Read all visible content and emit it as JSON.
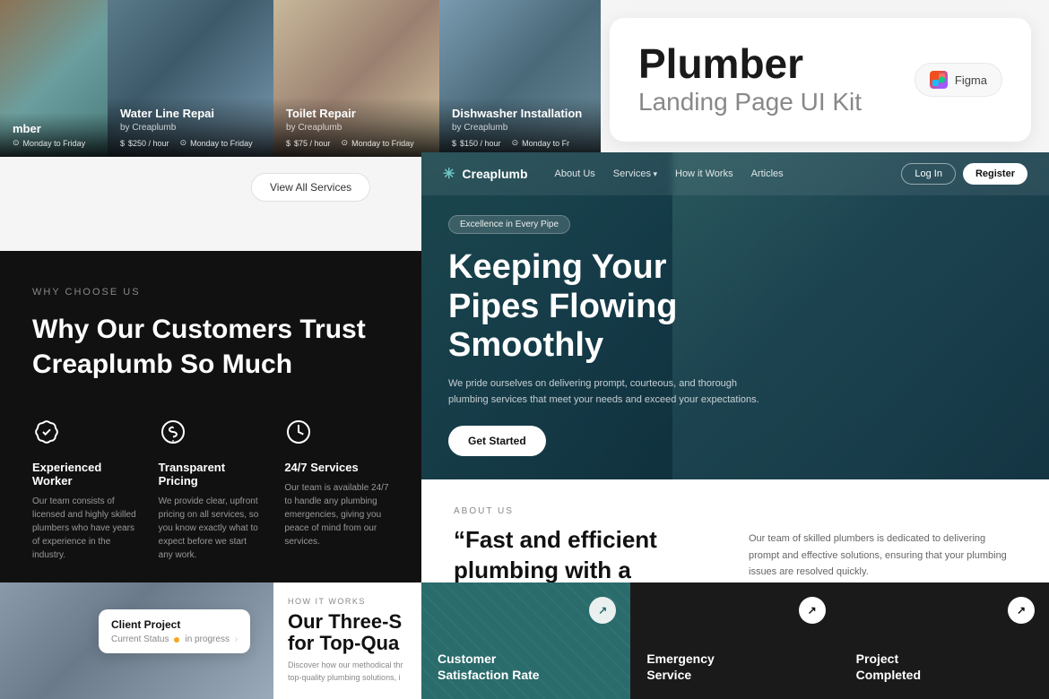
{
  "title_card": {
    "main": "Plumber",
    "sub": "Landing Page UI Kit",
    "figma": "Figma"
  },
  "service_cards": [
    {
      "id": "card-1",
      "title": "mber",
      "by": "",
      "price": "",
      "schedule": "Monday to Friday"
    },
    {
      "id": "card-2",
      "title": "Water Line Repai",
      "by": "by Creaplumb",
      "price": "$250 / hour",
      "schedule": "Monday to Friday"
    },
    {
      "id": "card-3",
      "title": "Toilet Repair",
      "by": "by Creaplumb",
      "price": "$75 / hour",
      "schedule": "Monday to Friday"
    },
    {
      "id": "card-4",
      "title": "Dishwasher Installation",
      "by": "by Creaplumb",
      "price": "$150 / hour",
      "schedule": "Monday to Fr"
    }
  ],
  "view_all_btn": "View All Services",
  "why_choose": {
    "label": "WHY CHOOSE US",
    "title": "Why Our Customers Trust Creaplumb So Much",
    "features": [
      {
        "icon": "badge-check",
        "title": "Experienced Worker",
        "desc": "Our team consists of licensed and highly skilled plumbers who have years of experience in the industry."
      },
      {
        "icon": "money",
        "title": "Transparent Pricing",
        "desc": "We provide clear, upfront pricing on all services, so you know exactly what to expect before we start any work."
      },
      {
        "icon": "clock",
        "title": "24/7 Services",
        "desc": "Our team is available 24/7 to handle any plumbing emergencies, giving you peace of mind from our services."
      }
    ]
  },
  "hero": {
    "logo": "Creaplumb",
    "nav": [
      "About Us",
      "Services",
      "How it Works",
      "Articles"
    ],
    "nav_services_arrow": true,
    "login": "Log In",
    "register": "Register",
    "badge": "Excellence in Every Pipe",
    "title": "Keeping Your Pipes Flowing Smoothly",
    "desc": "We pride ourselves on delivering prompt, courteous, and thorough plumbing services that meet your needs and exceed your expectations.",
    "cta": "Get Started"
  },
  "about": {
    "label": "ABOUT US",
    "quote": "“Fast and efficient plumbing with a professional touch.”",
    "desc": "Our team of skilled plumbers is dedicated to delivering prompt and effective solutions, ensuring that your plumbing issues are resolved quickly."
  },
  "how_it_works": {
    "label": "HOW IT WORKS",
    "title": "Our Three-S",
    "title_line2": "for Top-Qua",
    "desc": "Discover how our methodical thr top-quality plumbing solutions, i"
  },
  "client_card": {
    "title": "Client Project",
    "status_label": "Current Status",
    "status": "in progress"
  },
  "stat_cards": [
    {
      "title": "Customer\nSatisfaction Rate",
      "arrow": "↗"
    },
    {
      "title": "Emergency\nService",
      "arrow": "↗"
    },
    {
      "title": "Project\nCompleted",
      "arrow": "↗"
    }
  ]
}
